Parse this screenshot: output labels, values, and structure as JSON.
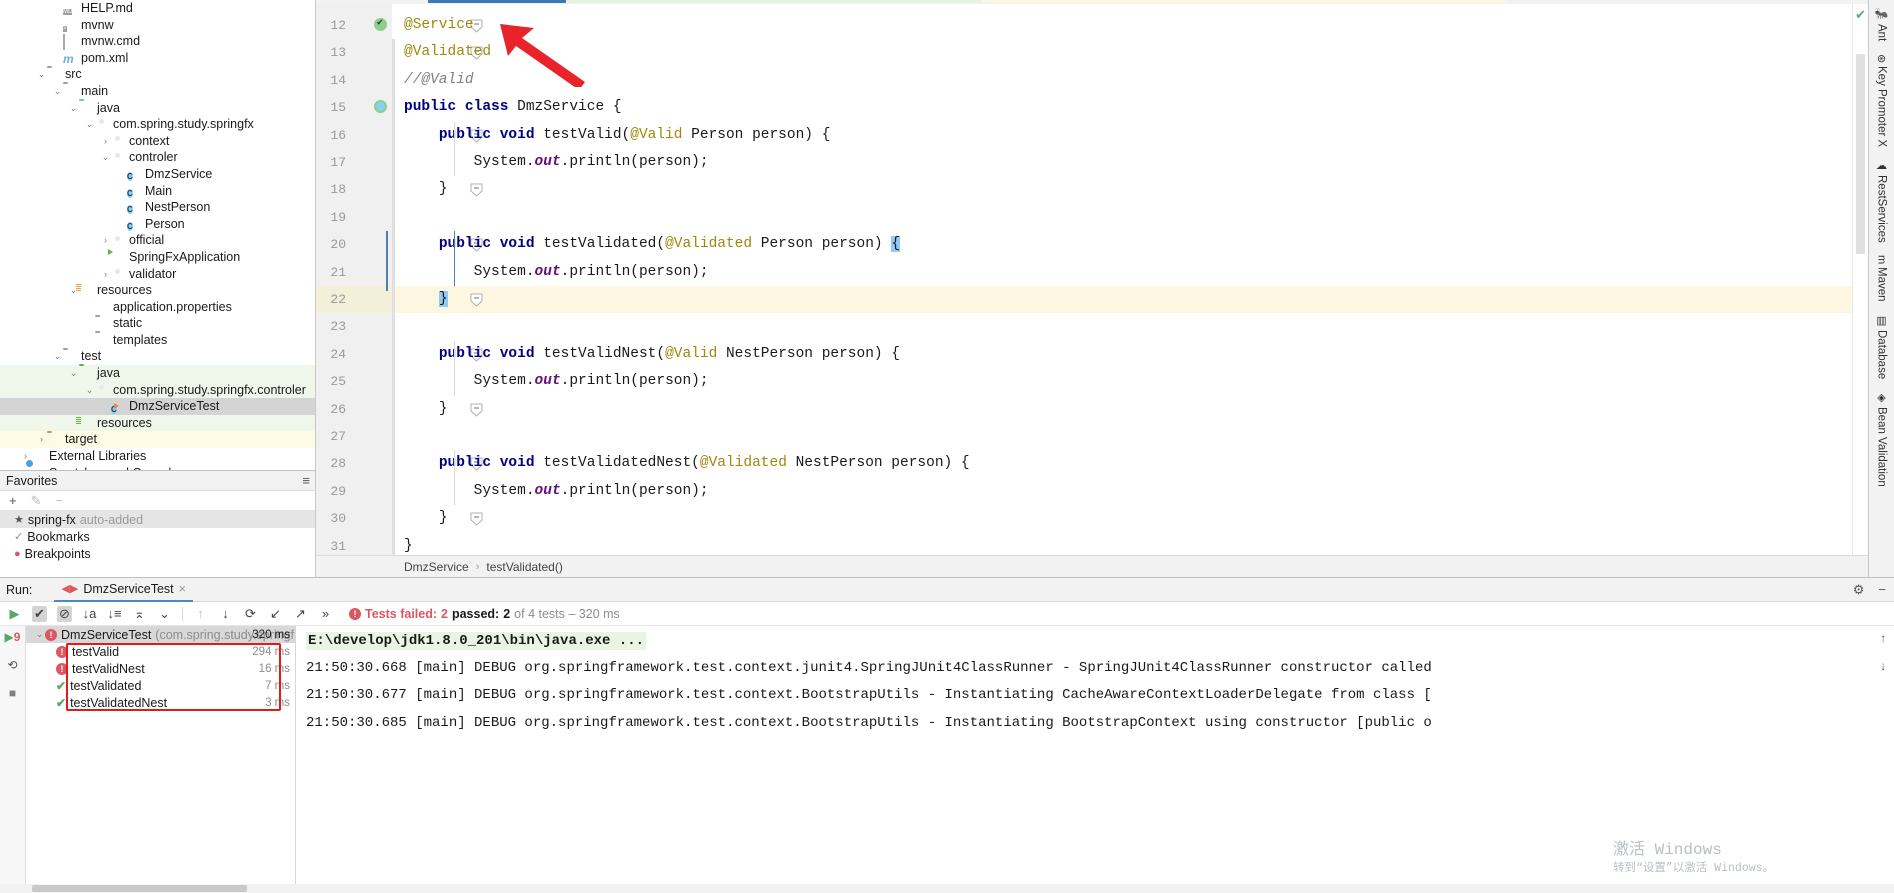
{
  "project_tree": [
    {
      "label": "HELP.md",
      "icon": "md-file-icon",
      "indent": 3,
      "arrow": "",
      "state": ""
    },
    {
      "label": "mvnw",
      "icon": "script-file-icon",
      "indent": 3,
      "arrow": "",
      "state": ""
    },
    {
      "label": "mvnw.cmd",
      "icon": "cmd-file-icon",
      "indent": 3,
      "arrow": "",
      "state": ""
    },
    {
      "label": "pom.xml",
      "icon": "maven-file-icon",
      "indent": 3,
      "arrow": "",
      "state": ""
    },
    {
      "label": "src",
      "icon": "folder-icon",
      "indent": 2,
      "arrow": "down",
      "state": ""
    },
    {
      "label": "main",
      "icon": "folder-icon",
      "indent": 3,
      "arrow": "down",
      "state": ""
    },
    {
      "label": "java",
      "icon": "source-folder-icon",
      "indent": 4,
      "arrow": "down",
      "state": ""
    },
    {
      "label": "com.spring.study.springfx",
      "icon": "package-icon",
      "indent": 5,
      "arrow": "down",
      "state": ""
    },
    {
      "label": "context",
      "icon": "package-icon",
      "indent": 6,
      "arrow": "right",
      "state": ""
    },
    {
      "label": "controler",
      "icon": "package-icon",
      "indent": 6,
      "arrow": "down",
      "state": ""
    },
    {
      "label": "DmzService",
      "icon": "java-class-icon",
      "indent": 7,
      "arrow": "",
      "state": ""
    },
    {
      "label": "Main",
      "icon": "java-class-icon",
      "indent": 7,
      "arrow": "",
      "state": ""
    },
    {
      "label": "NestPerson",
      "icon": "java-class-icon",
      "indent": 7,
      "arrow": "",
      "state": ""
    },
    {
      "label": "Person",
      "icon": "java-class-icon",
      "indent": 7,
      "arrow": "",
      "state": ""
    },
    {
      "label": "official",
      "icon": "package-icon",
      "indent": 6,
      "arrow": "right",
      "state": ""
    },
    {
      "label": "SpringFxApplication",
      "icon": "spring-class-icon",
      "indent": 6,
      "arrow": "",
      "state": ""
    },
    {
      "label": "validator",
      "icon": "package-icon",
      "indent": 6,
      "arrow": "right",
      "state": ""
    },
    {
      "label": "resources",
      "icon": "resources-folder-icon",
      "indent": 4,
      "arrow": "down",
      "state": ""
    },
    {
      "label": "application.properties",
      "icon": "properties-file-icon",
      "indent": 5,
      "arrow": "",
      "state": ""
    },
    {
      "label": "static",
      "icon": "folder-icon",
      "indent": 5,
      "arrow": "",
      "state": ""
    },
    {
      "label": "templates",
      "icon": "folder-icon",
      "indent": 5,
      "arrow": "",
      "state": ""
    },
    {
      "label": "test",
      "icon": "folder-icon",
      "indent": 3,
      "arrow": "down",
      "state": ""
    },
    {
      "label": "java",
      "icon": "test-source-folder-icon",
      "indent": 4,
      "arrow": "down",
      "state": "green"
    },
    {
      "label": "com.spring.study.springfx.controler",
      "icon": "package-icon",
      "indent": 5,
      "arrow": "down",
      "state": "green"
    },
    {
      "label": "DmzServiceTest",
      "icon": "java-test-class-icon",
      "indent": 6,
      "arrow": "",
      "state": "selected"
    },
    {
      "label": "resources",
      "icon": "test-resources-folder-icon",
      "indent": 4,
      "arrow": "",
      "state": "green"
    },
    {
      "label": "target",
      "icon": "excluded-folder-icon",
      "indent": 2,
      "arrow": "right",
      "state": "yellow"
    },
    {
      "label": "External Libraries",
      "icon": "libraries-icon",
      "indent": 1,
      "arrow": "right",
      "state": ""
    },
    {
      "label": "Scratches and Consoles",
      "icon": "scratches-icon",
      "indent": 1,
      "arrow": "",
      "state": ""
    }
  ],
  "favorites": {
    "title": "Favorites",
    "toolbar": {
      "add": "+",
      "edit": "✎",
      "remove": "−",
      "collapse": "≡"
    },
    "items": [
      {
        "label": "spring-fx",
        "suffix": "auto-added",
        "icon": "star-icon",
        "state": "selected"
      },
      {
        "label": "Bookmarks",
        "suffix": "",
        "icon": "bookmark-check-icon",
        "state": ""
      },
      {
        "label": "Breakpoints",
        "suffix": "",
        "icon": "breakpoint-icon",
        "state": ""
      }
    ]
  },
  "editor": {
    "lines": [
      {
        "n": 12,
        "indent": 0,
        "tokens": [
          {
            "t": "@Service",
            "c": "ann"
          }
        ],
        "gutter": "spring-bean-icon",
        "fold": "minus"
      },
      {
        "n": 13,
        "indent": 0,
        "tokens": [
          {
            "t": "@Validated",
            "c": "ann"
          }
        ],
        "gutter": "",
        "fold": "minus"
      },
      {
        "n": 14,
        "indent": 0,
        "tokens": [
          {
            "t": "//@Valid",
            "c": "cmt"
          }
        ],
        "gutter": "",
        "fold": ""
      },
      {
        "n": 15,
        "indent": 0,
        "tokens": [
          {
            "t": "public class ",
            "c": "kw"
          },
          {
            "t": "DmzService {",
            "c": "pln"
          }
        ],
        "gutter": "class-icon",
        "fold": ""
      },
      {
        "n": 16,
        "indent": 1,
        "tokens": [
          {
            "t": "public void ",
            "c": "kw"
          },
          {
            "t": "testValid(",
            "c": "pln"
          },
          {
            "t": "@Valid",
            "c": "ann"
          },
          {
            "t": " Person person) {",
            "c": "pln"
          }
        ],
        "gutter": "",
        "fold": "minus"
      },
      {
        "n": 17,
        "indent": 2,
        "tokens": [
          {
            "t": "System.",
            "c": "pln"
          },
          {
            "t": "out",
            "c": "fld"
          },
          {
            "t": ".println(person);",
            "c": "pln"
          }
        ],
        "gutter": "",
        "fold": ""
      },
      {
        "n": 18,
        "indent": 1,
        "tokens": [
          {
            "t": "}",
            "c": "pln"
          }
        ],
        "gutter": "",
        "fold": "minus"
      },
      {
        "n": 19,
        "indent": 0,
        "tokens": [],
        "gutter": "",
        "fold": ""
      },
      {
        "n": 20,
        "indent": 1,
        "tokens": [
          {
            "t": "public void ",
            "c": "kw"
          },
          {
            "t": "testValidated(",
            "c": "pln"
          },
          {
            "t": "@Validated",
            "c": "ann"
          },
          {
            "t": " Person person) ",
            "c": "pln"
          },
          {
            "t": "{",
            "c": "brace"
          }
        ],
        "gutter": "",
        "fold": "minus"
      },
      {
        "n": 21,
        "indent": 2,
        "tokens": [
          {
            "t": "System.",
            "c": "pln"
          },
          {
            "t": "out",
            "c": "fld"
          },
          {
            "t": ".println(person);",
            "c": "pln"
          }
        ],
        "gutter": "",
        "fold": ""
      },
      {
        "n": 22,
        "indent": 1,
        "tokens": [
          {
            "t": "}",
            "c": "brace"
          }
        ],
        "gutter": "",
        "fold": "minus"
      },
      {
        "n": 23,
        "indent": 0,
        "tokens": [],
        "gutter": "",
        "fold": ""
      },
      {
        "n": 24,
        "indent": 1,
        "tokens": [
          {
            "t": "public void ",
            "c": "kw"
          },
          {
            "t": "testValidNest(",
            "c": "pln"
          },
          {
            "t": "@Valid",
            "c": "ann"
          },
          {
            "t": " NestPerson person) {",
            "c": "pln"
          }
        ],
        "gutter": "",
        "fold": "minus"
      },
      {
        "n": 25,
        "indent": 2,
        "tokens": [
          {
            "t": "System.",
            "c": "pln"
          },
          {
            "t": "out",
            "c": "fld"
          },
          {
            "t": ".println(person);",
            "c": "pln"
          }
        ],
        "gutter": "",
        "fold": ""
      },
      {
        "n": 26,
        "indent": 1,
        "tokens": [
          {
            "t": "}",
            "c": "pln"
          }
        ],
        "gutter": "",
        "fold": "minus"
      },
      {
        "n": 27,
        "indent": 0,
        "tokens": [],
        "gutter": "",
        "fold": ""
      },
      {
        "n": 28,
        "indent": 1,
        "tokens": [
          {
            "t": "public void ",
            "c": "kw"
          },
          {
            "t": "testValidatedNest(",
            "c": "pln"
          },
          {
            "t": "@Validated",
            "c": "ann"
          },
          {
            "t": " NestPerson person) {",
            "c": "pln"
          }
        ],
        "gutter": "",
        "fold": "minus"
      },
      {
        "n": 29,
        "indent": 2,
        "tokens": [
          {
            "t": "System.",
            "c": "pln"
          },
          {
            "t": "out",
            "c": "fld"
          },
          {
            "t": ".println(person);",
            "c": "pln"
          }
        ],
        "gutter": "",
        "fold": ""
      },
      {
        "n": 30,
        "indent": 1,
        "tokens": [
          {
            "t": "}",
            "c": "pln"
          }
        ],
        "gutter": "",
        "fold": "minus"
      },
      {
        "n": 31,
        "indent": 0,
        "tokens": [
          {
            "t": "}",
            "c": "pln"
          }
        ],
        "gutter": "",
        "fold": ""
      }
    ],
    "current_line": 22,
    "breadcrumb": {
      "class": "DmzService",
      "sep": "›",
      "method": "testValidated()"
    },
    "stripe_status": "✔"
  },
  "right_tool_tabs": [
    {
      "label": "Ant",
      "icon": "ant-icon"
    },
    {
      "label": "Key Promoter X",
      "icon": "key-promoter-icon"
    },
    {
      "label": "RestServices",
      "icon": "rest-services-icon"
    },
    {
      "label": "Maven",
      "icon": "maven-icon"
    },
    {
      "label": "Database",
      "icon": "database-icon"
    },
    {
      "label": "Bean Validation",
      "icon": "bean-validation-icon"
    }
  ],
  "run_panel": {
    "label": "Run:",
    "tab_title": "DmzServiceTest",
    "tab_close": "×",
    "header_right": {
      "settings": "⚙",
      "minimize": "−"
    },
    "toolbar_more": "»",
    "status": {
      "failed_label": "Tests failed:",
      "failed_count": "2",
      "passed_label": "passed:",
      "passed_count": "2",
      "suffix": "of 4 tests – 320 ms"
    },
    "tree": [
      {
        "label": "DmzServiceTest",
        "suffix": "(com.spring.study.springf",
        "time": "320 ms",
        "status": "failed",
        "indent": 0,
        "selected": true
      },
      {
        "label": "testValid",
        "suffix": "",
        "time": "294 ms",
        "status": "failed",
        "indent": 1,
        "selected": false
      },
      {
        "label": "testValidNest",
        "suffix": "",
        "time": "16 ms",
        "status": "failed",
        "indent": 1,
        "selected": false
      },
      {
        "label": "testValidated",
        "suffix": "",
        "time": "7 ms",
        "status": "passed",
        "indent": 1,
        "selected": false
      },
      {
        "label": "testValidatedNest",
        "suffix": "",
        "time": "3 ms",
        "status": "passed",
        "indent": 1,
        "selected": false
      }
    ],
    "left_icons": [
      "rerun-icon",
      "rerun-failed-icon",
      "stop-icon"
    ],
    "console_lines": [
      {
        "text": "E:\\develop\\jdk1.8.0_201\\bin\\java.exe ...",
        "cmd": true
      },
      {
        "text": "21:50:30.668 [main] DEBUG org.springframework.test.context.junit4.SpringJUnit4ClassRunner - SpringJUnit4ClassRunner constructor called",
        "cmd": false
      },
      {
        "text": "21:50:30.677 [main] DEBUG org.springframework.test.context.BootstrapUtils - Instantiating CacheAwareContextLoaderDelegate from class [",
        "cmd": false
      },
      {
        "text": "21:50:30.685 [main] DEBUG org.springframework.test.context.BootstrapUtils - Instantiating BootstrapContext using constructor [public o",
        "cmd": false
      }
    ],
    "console_side_icons": [
      "scroll-up-icon",
      "scroll-down-icon",
      "soft-wrap-icon"
    ]
  },
  "watermark": {
    "line1": "激活 Windows",
    "line2": "转到“设置”以激活 Windows。"
  },
  "colors": {
    "accent_blue": "#3d7ab5",
    "fail_red": "#db5860",
    "pass_green": "#59a869",
    "annotation_yellow": "#9e880d",
    "keyword_navy": "#000080",
    "arrow_red": "#e01b1b",
    "current_line": "#fdf7e2"
  }
}
